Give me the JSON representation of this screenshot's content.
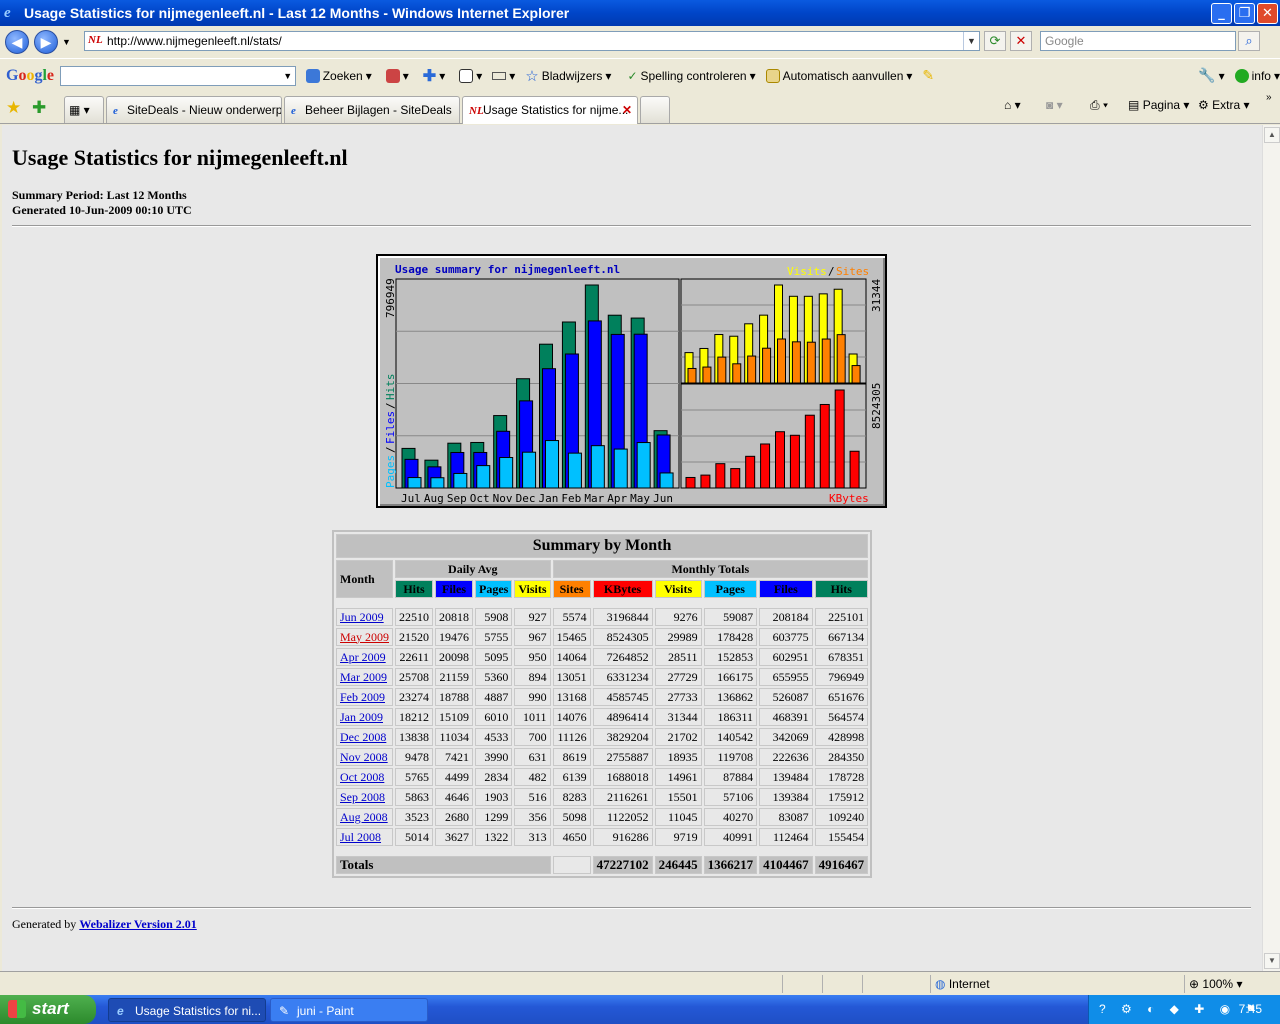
{
  "window": {
    "title": "Usage Statistics for nijmegenleeft.nl - Last 12 Months - Windows Internet Explorer"
  },
  "address": {
    "url": "http://www.nijmegenleeft.nl/stats/",
    "search_placeholder": "Google"
  },
  "google_toolbar": {
    "logo": "Google",
    "search": "Zoeken",
    "bookmarks": "Bladwijzers",
    "spell": "Spelling controleren",
    "autofill": "Automatisch aanvullen",
    "info": "info"
  },
  "tabs": [
    {
      "label": "SiteDeals - Nieuw onderwerp..."
    },
    {
      "label": "Beheer Bijlagen - SiteDeals"
    },
    {
      "label": "Usage Statistics for nijme..."
    }
  ],
  "commands": {
    "page": "Pagina",
    "extra": "Extra"
  },
  "page": {
    "heading": "Usage Statistics for nijmegenleeft.nl",
    "summary_period": "Summary Period: Last 12 Months",
    "generated": "Generated 10-Jun-2009 00:10 UTC",
    "footer_prefix": "Generated by ",
    "footer_link": "Webalizer Version 2.01"
  },
  "chart_data": {
    "type": "bar",
    "title": "Usage summary for nijmegenleeft.nl",
    "categories": [
      "Jul",
      "Aug",
      "Sep",
      "Oct",
      "Nov",
      "Dec",
      "Jan",
      "Feb",
      "Mar",
      "Apr",
      "May",
      "Jun"
    ],
    "left_max_label": "796949",
    "visits_max_label": "31344",
    "kbytes_max_label": "8524305",
    "legend_left": [
      "Pages",
      "Files",
      "Hits"
    ],
    "legend_top": [
      "Visits",
      "Sites"
    ],
    "legend_bottom": "KBytes",
    "colors": {
      "hits": "#00805c",
      "files": "#0000ff",
      "pages": "#00c0ff",
      "visits": "#ffff00",
      "sites": "#ff8000",
      "kbytes": "#ff0000",
      "title": "#0000c0"
    },
    "series": [
      {
        "name": "Hits",
        "values": [
          155454,
          109240,
          175912,
          178728,
          284350,
          428998,
          564574,
          651676,
          796949,
          678351,
          667134,
          225101
        ]
      },
      {
        "name": "Files",
        "values": [
          112464,
          83087,
          139384,
          139484,
          222636,
          342069,
          468391,
          526087,
          655955,
          602951,
          603775,
          208184
        ]
      },
      {
        "name": "Pages",
        "values": [
          40991,
          40270,
          57106,
          87884,
          119708,
          140542,
          186311,
          136862,
          166175,
          152853,
          178428,
          59087
        ]
      },
      {
        "name": "Visits",
        "values": [
          9719,
          11045,
          15501,
          14961,
          18935,
          21702,
          31344,
          27733,
          27729,
          28511,
          29989,
          9276
        ]
      },
      {
        "name": "Sites",
        "values": [
          4650,
          5098,
          8283,
          6139,
          8619,
          11126,
          14076,
          13168,
          13051,
          14064,
          15465,
          5574
        ]
      },
      {
        "name": "KBytes",
        "values": [
          916286,
          1122052,
          2116261,
          1688018,
          2755887,
          3829204,
          4896414,
          4585745,
          6331234,
          7264852,
          8524305,
          3196844
        ]
      }
    ]
  },
  "table": {
    "caption": "Summary by Month",
    "month_header": "Month",
    "daily_avg": "Daily Avg",
    "monthly_totals": "Monthly Totals",
    "cols": [
      "Hits",
      "Files",
      "Pages",
      "Visits",
      "Sites",
      "KBytes",
      "Visits",
      "Pages",
      "Files",
      "Hits"
    ],
    "rows": [
      [
        "Jun 2009",
        "22510",
        "20818",
        "5908",
        "927",
        "5574",
        "3196844",
        "9276",
        "59087",
        "208184",
        "225101"
      ],
      [
        "May 2009",
        "21520",
        "19476",
        "5755",
        "967",
        "15465",
        "8524305",
        "29989",
        "178428",
        "603775",
        "667134"
      ],
      [
        "Apr 2009",
        "22611",
        "20098",
        "5095",
        "950",
        "14064",
        "7264852",
        "28511",
        "152853",
        "602951",
        "678351"
      ],
      [
        "Mar 2009",
        "25708",
        "21159",
        "5360",
        "894",
        "13051",
        "6331234",
        "27729",
        "166175",
        "655955",
        "796949"
      ],
      [
        "Feb 2009",
        "23274",
        "18788",
        "4887",
        "990",
        "13168",
        "4585745",
        "27733",
        "136862",
        "526087",
        "651676"
      ],
      [
        "Jan 2009",
        "18212",
        "15109",
        "6010",
        "1011",
        "14076",
        "4896414",
        "31344",
        "186311",
        "468391",
        "564574"
      ],
      [
        "Dec 2008",
        "13838",
        "11034",
        "4533",
        "700",
        "11126",
        "3829204",
        "21702",
        "140542",
        "342069",
        "428998"
      ],
      [
        "Nov 2008",
        "9478",
        "7421",
        "3990",
        "631",
        "8619",
        "2755887",
        "18935",
        "119708",
        "222636",
        "284350"
      ],
      [
        "Oct 2008",
        "5765",
        "4499",
        "2834",
        "482",
        "6139",
        "1688018",
        "14961",
        "87884",
        "139484",
        "178728"
      ],
      [
        "Sep 2008",
        "5863",
        "4646",
        "1903",
        "516",
        "8283",
        "2116261",
        "15501",
        "57106",
        "139384",
        "175912"
      ],
      [
        "Aug 2008",
        "3523",
        "2680",
        "1299",
        "356",
        "5098",
        "1122052",
        "11045",
        "40270",
        "83087",
        "109240"
      ],
      [
        "Jul 2008",
        "5014",
        "3627",
        "1322",
        "313",
        "4650",
        "916286",
        "9719",
        "40991",
        "112464",
        "155454"
      ]
    ],
    "totals": {
      "label": "Totals",
      "kbytes": "47227102",
      "visits": "246445",
      "pages": "1366217",
      "files": "4104467",
      "hits": "4916467"
    }
  },
  "status": {
    "zone": "Internet",
    "zoom": "100%"
  },
  "taskbar": {
    "start": "start",
    "tasks": [
      "Usage Statistics for ni...",
      "juni - Paint"
    ],
    "clock": "7:45"
  }
}
